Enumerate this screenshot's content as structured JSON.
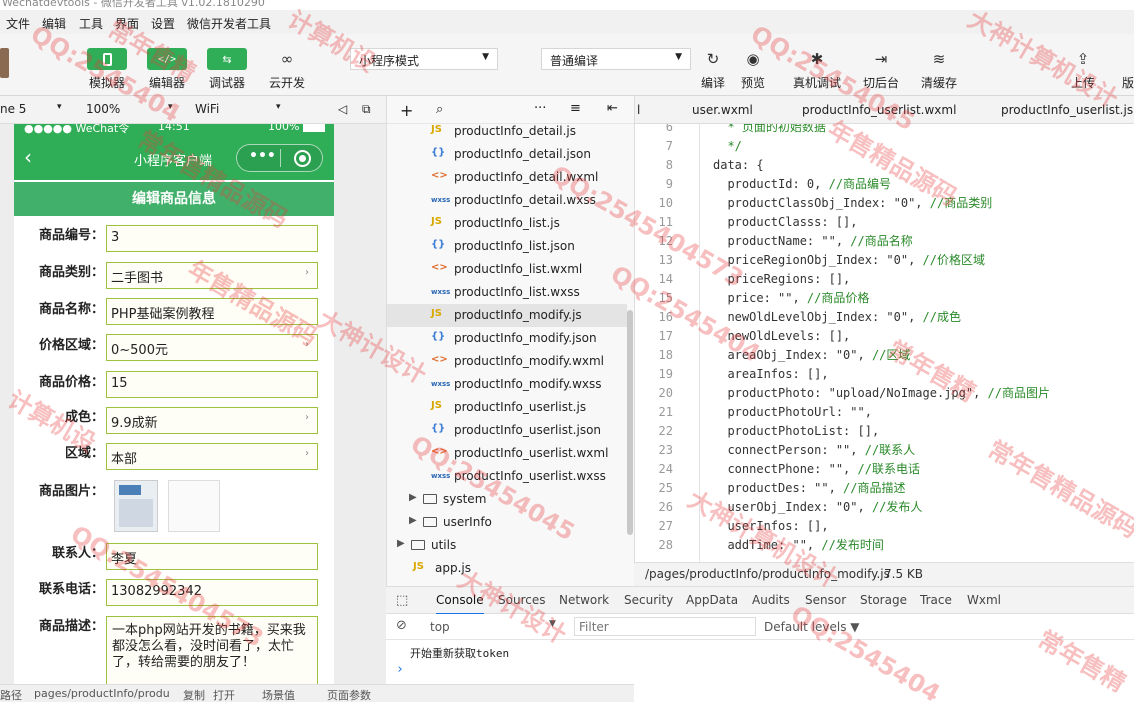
{
  "window": {
    "title": "Wechatdevtools - 微信开发者工具 v1.02.1810290"
  },
  "menubar": [
    "文件",
    "编辑",
    "工具",
    "界面",
    "设置",
    "微信开发者工具"
  ],
  "toolbar": {
    "simulator_label": "模拟器",
    "editor_label": "编辑器",
    "debugger_label": "调试器",
    "cloud_label": "云开发",
    "mode_select": "小程序模式",
    "compile_select": "普通编译",
    "compile_label": "编译",
    "preview_label": "预览",
    "remote_debug_label": "真机调试",
    "background_label": "切后台",
    "clear_cache_label": "清缓存",
    "upload_label": "上传",
    "version_label": "版"
  },
  "simbar": {
    "device": "ne 5",
    "zoom": "100%",
    "network": "WiFi"
  },
  "phone": {
    "status_left": "●●●●● WeChat令",
    "status_time": "14:51",
    "status_batt": "100%",
    "nav_title": "小程序客户端",
    "page_header": "编辑商品信息",
    "fields": [
      {
        "label": "商品编号：",
        "value": "3",
        "dropdown": false
      },
      {
        "label": "商品类别：",
        "value": "二手图书",
        "dropdown": true
      },
      {
        "label": "商品名称：",
        "value": "PHP基础案例教程",
        "dropdown": false
      },
      {
        "label": "价格区域：",
        "value": "0~500元",
        "dropdown": true
      },
      {
        "label": "商品价格：",
        "value": "15",
        "dropdown": false
      },
      {
        "label": "成色：",
        "value": "9.9成新",
        "dropdown": true
      },
      {
        "label": "区域：",
        "value": "本部",
        "dropdown": true
      }
    ],
    "image_label": "商品图片：",
    "contact_label": "联系人：",
    "contact_value": "李夏",
    "phone_label": "联系电话：",
    "phone_value": "13082992342",
    "desc_label": "商品描述：",
    "desc_value": "一本php网站开发的书籍，买来我都没怎么看，没时间看了，太忙了，转给需要的朋友了！"
  },
  "statusline": {
    "path_label": "路径",
    "path": "pages/productInfo/produ",
    "copy": "复制",
    "open": "打开",
    "scene": "场景值",
    "params": "页面参数"
  },
  "explorer": {
    "files": [
      {
        "type": "JS",
        "name": "productInfo_detail.js"
      },
      {
        "type": "{}",
        "name": "productInfo_detail.json"
      },
      {
        "type": "<>",
        "name": "productInfo_detail.wxml"
      },
      {
        "type": "wxss",
        "name": "productInfo_detail.wxss"
      },
      {
        "type": "JS",
        "name": "productInfo_list.js"
      },
      {
        "type": "{}",
        "name": "productInfo_list.json"
      },
      {
        "type": "<>",
        "name": "productInfo_list.wxml"
      },
      {
        "type": "wxss",
        "name": "productInfo_list.wxss"
      },
      {
        "type": "JS",
        "name": "productInfo_modify.js"
      },
      {
        "type": "{}",
        "name": "productInfo_modify.json"
      },
      {
        "type": "<>",
        "name": "productInfo_modify.wxml"
      },
      {
        "type": "wxss",
        "name": "productInfo_modify.wxss"
      },
      {
        "type": "JS",
        "name": "productInfo_userlist.js"
      },
      {
        "type": "{}",
        "name": "productInfo_userlist.json"
      },
      {
        "type": "<>",
        "name": "productInfo_userlist.wxml"
      },
      {
        "type": "wxss",
        "name": "productInfo_userlist.wxss"
      }
    ],
    "folders": [
      "system",
      "userInfo",
      "utils"
    ],
    "appjs": "app.js"
  },
  "editor": {
    "tabs": [
      "l",
      "user.wxml",
      "productInfo_userlist.wxml",
      "productInfo_userlist.js"
    ],
    "lines": [
      {
        "n": "6",
        "code": "  * 页面的初始数据",
        "comment": ""
      },
      {
        "n": "7",
        "code": "  */",
        "comment": ""
      },
      {
        "n": "8",
        "code": "data: {",
        "comment": ""
      },
      {
        "n": "9",
        "code": "  productId: 0, ",
        "comment": "//商品编号"
      },
      {
        "n": "10",
        "code": "  productClassObj_Index: \"0\", ",
        "comment": "//商品类别"
      },
      {
        "n": "11",
        "code": "  productClasss: [],",
        "comment": ""
      },
      {
        "n": "12",
        "code": "  productName: \"\", ",
        "comment": "//商品名称"
      },
      {
        "n": "13",
        "code": "  priceRegionObj_Index: \"0\", ",
        "comment": "//价格区域"
      },
      {
        "n": "14",
        "code": "  priceRegions: [],",
        "comment": ""
      },
      {
        "n": "15",
        "code": "  price: \"\", ",
        "comment": "//商品价格"
      },
      {
        "n": "16",
        "code": "  newOldLevelObj_Index: \"0\", ",
        "comment": "//成色"
      },
      {
        "n": "17",
        "code": "  newOldLevels: [],",
        "comment": ""
      },
      {
        "n": "18",
        "code": "  areaObj_Index: \"0\", ",
        "comment": "//区域"
      },
      {
        "n": "19",
        "code": "  areaInfos: [],",
        "comment": ""
      },
      {
        "n": "20",
        "code": "  productPhoto: \"upload/NoImage.jpg\", ",
        "comment": "//商品图片"
      },
      {
        "n": "21",
        "code": "  productPhotoUrl: \"\",",
        "comment": ""
      },
      {
        "n": "22",
        "code": "  productPhotoList: [],",
        "comment": ""
      },
      {
        "n": "23",
        "code": "  connectPerson: \"\", ",
        "comment": "//联系人"
      },
      {
        "n": "24",
        "code": "  connectPhone: \"\", ",
        "comment": "//联系电话"
      },
      {
        "n": "25",
        "code": "  productDes: \"\", ",
        "comment": "//商品描述"
      },
      {
        "n": "26",
        "code": "  userObj_Index: \"0\", ",
        "comment": "//发布人"
      },
      {
        "n": "27",
        "code": "  userInfos: [],",
        "comment": ""
      },
      {
        "n": "28",
        "code": "  addTime: \"\", ",
        "comment": "//发布时间"
      }
    ],
    "filepath": "/pages/productInfo/productInfo_modify.js",
    "filesize": "7.5 KB"
  },
  "devtools": {
    "tabs": [
      "Console",
      "Sources",
      "Network",
      "Security",
      "AppData",
      "Audits",
      "Sensor",
      "Storage",
      "Trace",
      "Wxml"
    ],
    "context": "top",
    "filter_placeholder": "Filter",
    "levels": "Default levels ▼",
    "log": "开始重新获取token",
    "prompt": "›"
  },
  "watermark": [
    "QQ:2545404",
    "常年售精",
    "计算机设",
    "QQ:25454045",
    "大神计算机设计",
    "常年售精品源码",
    "QQ:2545404573",
    "年售精品源码",
    "大神计设计"
  ],
  "colors": {
    "accent": "#2fae57",
    "header": "#41b06b"
  }
}
